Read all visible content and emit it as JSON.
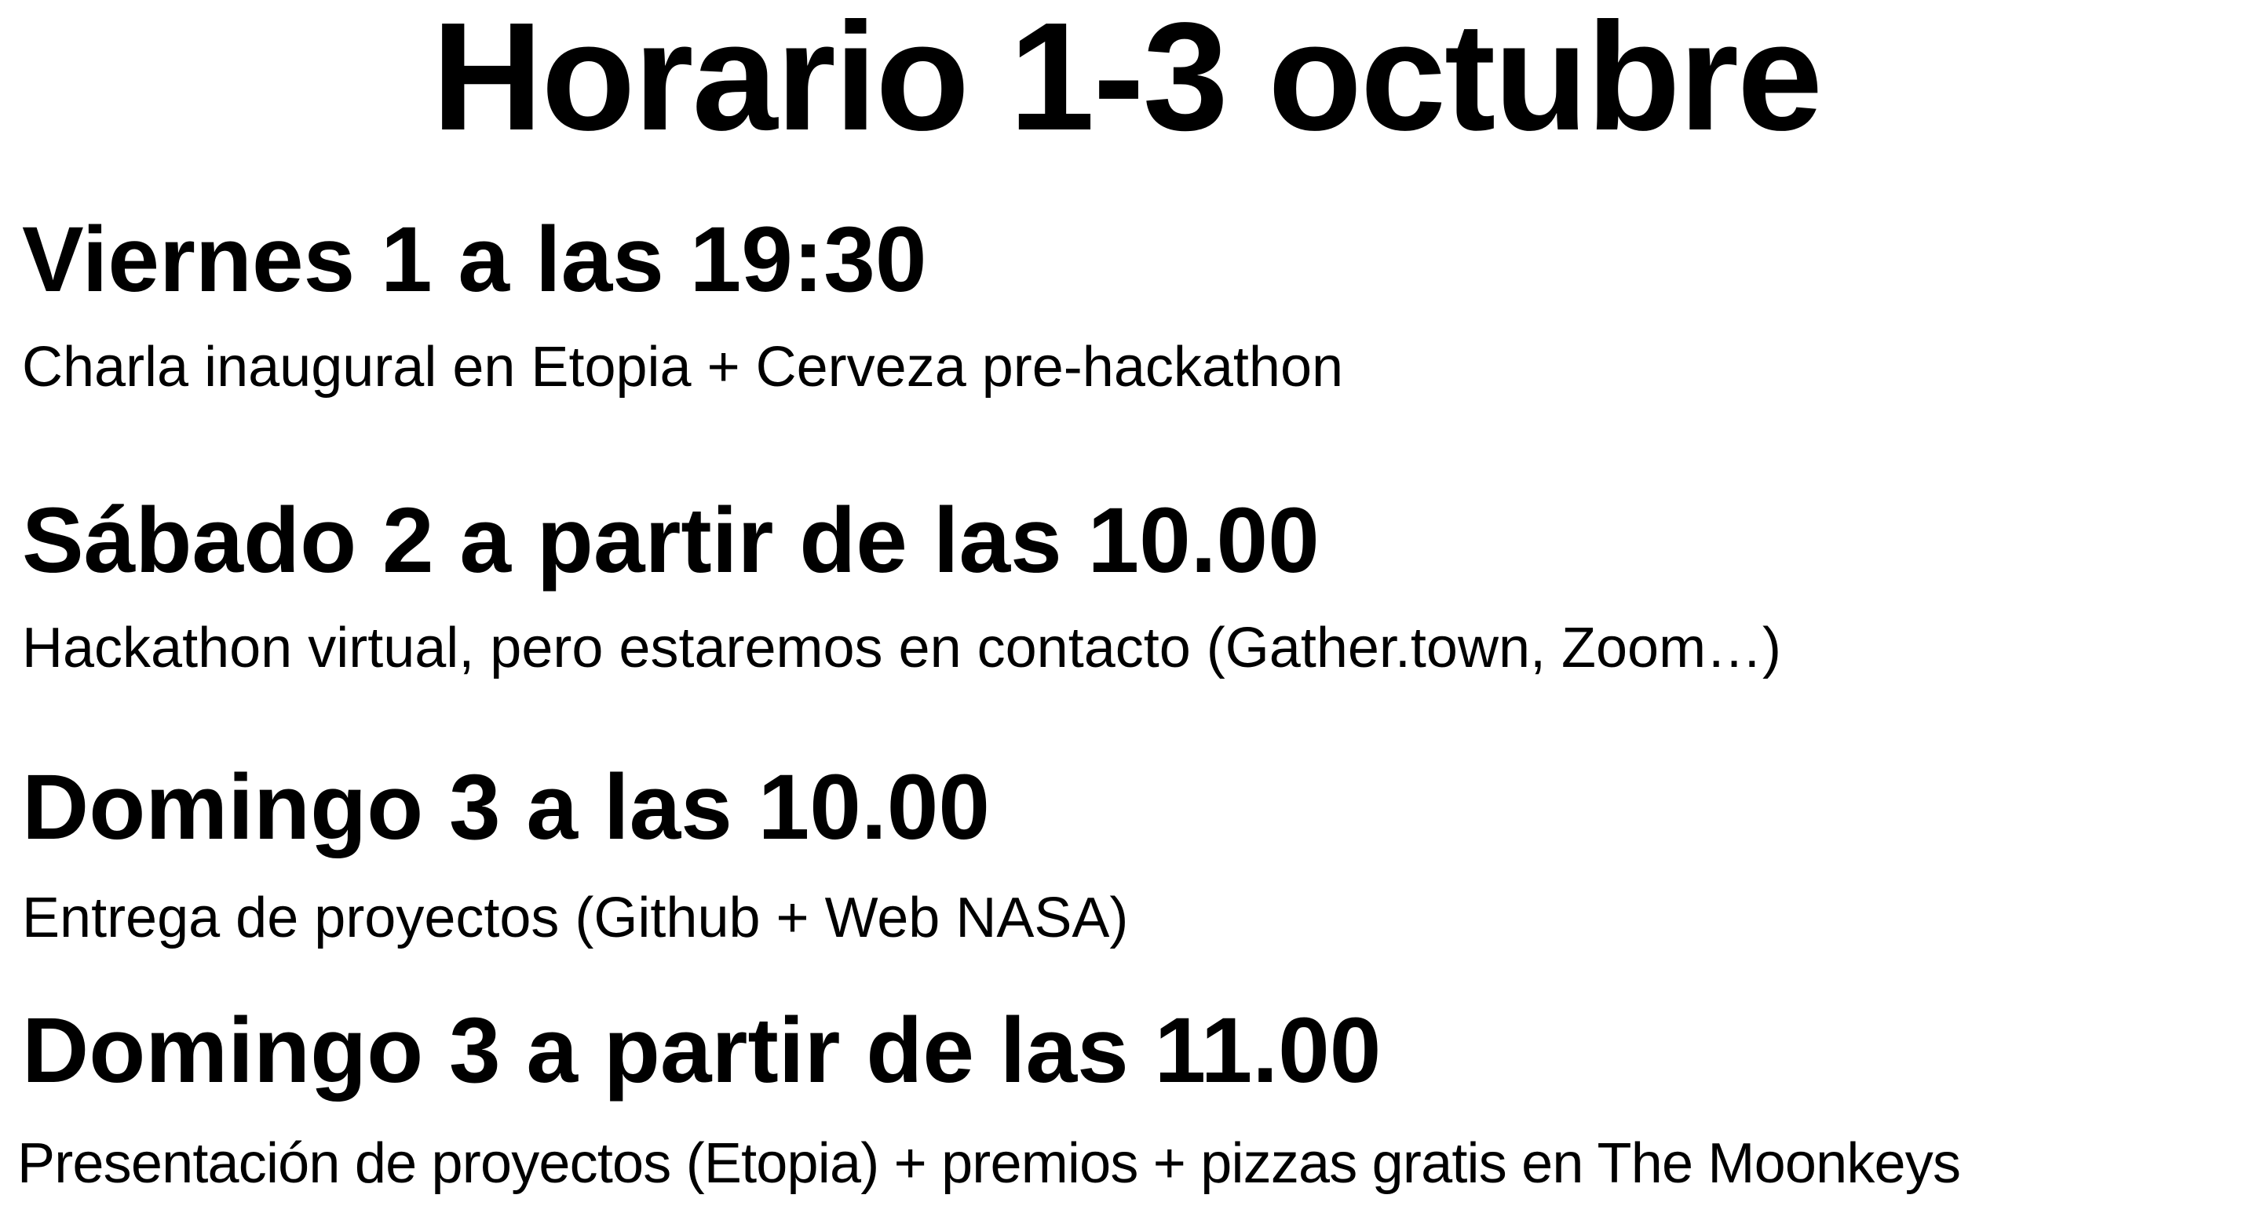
{
  "title": "Horario 1-3 octubre",
  "schedule": [
    {
      "heading": "Viernes 1 a las 19:30",
      "description": "Charla inaugural en Etopia + Cerveza pre-hackathon"
    },
    {
      "heading": "Sábado 2 a partir de las 10.00",
      "description": "Hackathon virtual, pero estaremos en contacto (Gather.town, Zoom…)"
    },
    {
      "heading": "Domingo 3 a las 10.00",
      "description": "Entrega de proyectos (Github + Web NASA)"
    },
    {
      "heading": "Domingo 3 a partir de las 11.00",
      "description": "Presentación de proyectos (Etopia) + premios + pizzas gratis en The Moonkeys"
    }
  ]
}
